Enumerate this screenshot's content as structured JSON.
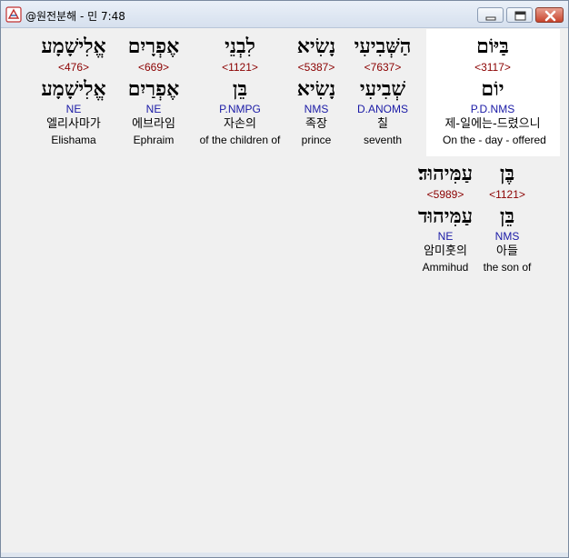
{
  "window": {
    "title": "@원전분해 - 민 7:48",
    "icon": "bible-app-icon"
  },
  "controls": {
    "minimize": "minimize-icon",
    "maximize": "maximize-icon",
    "close": "close-icon"
  },
  "words": [
    {
      "hebrew": "בַּיּוֹם",
      "strong": "<3117>",
      "lemma": "יוֹם",
      "parse": "P.D.NMS",
      "korean": "제-일에는-드렸으니",
      "english": "On the - day - offered"
    },
    {
      "hebrew": "הַשְּׁבִיעִי",
      "strong": "<7637>",
      "lemma": "שְׁבִיעִי",
      "parse": "D.ANOMS",
      "korean": "칠",
      "english": "seventh"
    },
    {
      "hebrew": "נָשִׂיא",
      "strong": "<5387>",
      "lemma": "נָשִׂיא",
      "parse": "NMS",
      "korean": "족장",
      "english": "prince"
    },
    {
      "hebrew": "לִבְנֵי",
      "strong": "<1121>",
      "lemma": "בֵּן",
      "parse": "P.NMPG",
      "korean": "자손의",
      "english": "of the children of"
    },
    {
      "hebrew": "אֶפְרָיִם",
      "strong": "<669>",
      "lemma": "אֶפְרַיִם",
      "parse": "NE",
      "korean": "에브라임",
      "english": "Ephraim"
    },
    {
      "hebrew": "אֱלִישָׁמָע",
      "strong": "<476>",
      "lemma": "אֱלִישָׁמָע",
      "parse": "NE",
      "korean": "엘리사마가",
      "english": "Elishama"
    },
    {
      "hebrew": "בֶּן",
      "strong": "<1121>",
      "lemma": "בֵּן",
      "parse": "NMS",
      "korean": "아들",
      "english": "the son of"
    },
    {
      "hebrew": "עַמִּיהוּד׃",
      "strong": "<5989>",
      "lemma": "עַמִּיהוּד",
      "parse": "NE",
      "korean": "암미훗의",
      "english": "Ammihud"
    }
  ]
}
